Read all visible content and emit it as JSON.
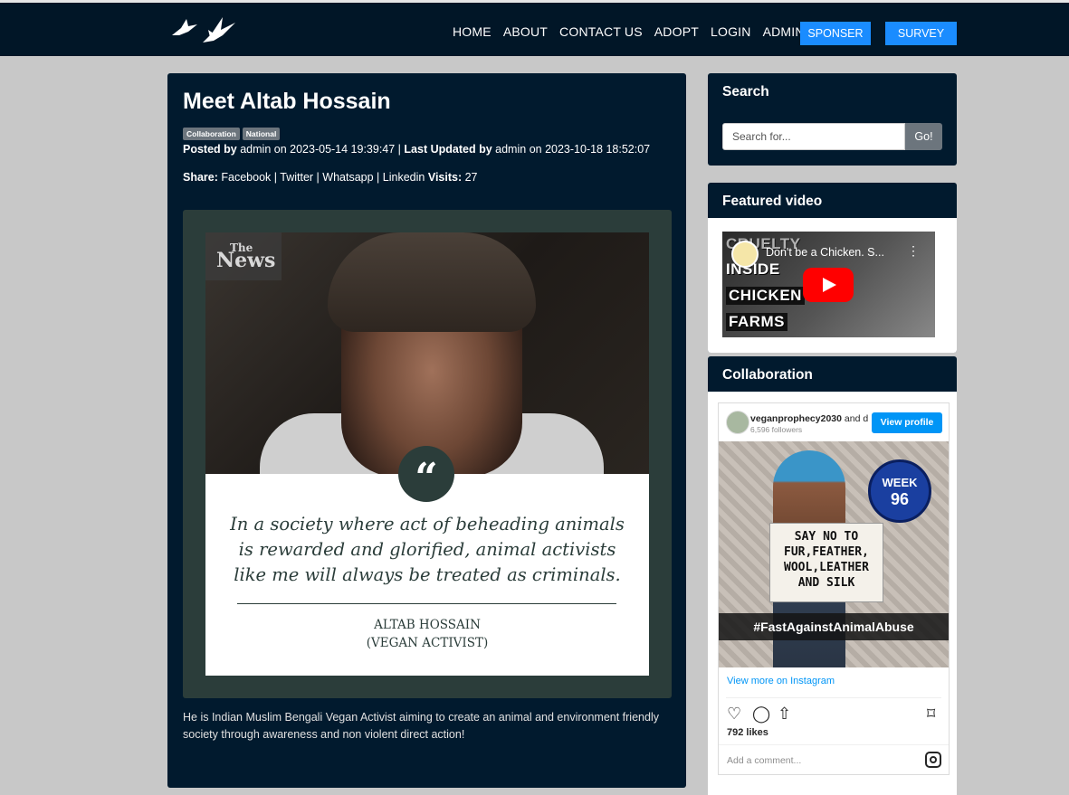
{
  "nav": {
    "links": [
      "HOME",
      "ABOUT",
      "CONTACT US",
      "ADOPT",
      "LOGIN",
      "ADMIN"
    ],
    "sponser": "SPONSER",
    "survey": "SURVEY"
  },
  "post": {
    "title": "Meet Altab Hossain",
    "badges": [
      "Collaboration",
      "National"
    ],
    "posted_by_label": "Posted by",
    "posted_by": "admin",
    "posted_on": "on 2023-05-14 19:39:47 |",
    "updated_label": "Last Updated by",
    "updated_by": "admin",
    "updated_on": "on 2023-10-18 18:52:07",
    "share_label": "Share:",
    "share_links": [
      "Facebook",
      "Twitter",
      "Whatsapp",
      "Linkedin"
    ],
    "visits_label": "Visits:",
    "visits": "27",
    "image": {
      "logo_the": "The",
      "logo_news": "News",
      "quote_mark": "“",
      "quote_lines": [
        "In a society where act of beheading animals",
        "is rewarded and glorified, animal activists",
        "like me will always be treated as criminals."
      ],
      "author": "ALTAB HOSSAIN",
      "author_role": "(VEGAN ACTIVIST)"
    },
    "description": "He is Indian Muslim Bengali Vegan Activist aiming to create an animal and environment friendly society through awareness and non violent direct action!"
  },
  "sidebar": {
    "search": {
      "title": "Search",
      "placeholder": "Search for...",
      "button": "Go!"
    },
    "video": {
      "title": "Featured video",
      "video_title": "Don't be a Chicken. S...",
      "thumb_words": [
        "CRUELTY",
        "INSIDE",
        "CHICKEN",
        "FARMS"
      ]
    },
    "collab": {
      "title": "Collaboration",
      "insta": {
        "user": "veganprophecy2030",
        "user_suffix": "and d",
        "followers": "6,596 followers",
        "view_profile": "View profile",
        "week_label": "WEEK",
        "week_num": "96",
        "sign_lines": [
          "SAY NO TO",
          "FUR,FEATHER,",
          "WOOL,LEATHER",
          "AND SILK"
        ],
        "hashtag": "#FastAgainstAnimalAbuse",
        "view_more": "View more on Instagram",
        "likes": "792 likes",
        "comment_placeholder": "Add a comment..."
      }
    }
  },
  "colors": {
    "navbar": "#011627",
    "card": "#011a2e",
    "accent": "#1a8cff",
    "page_bg": "#c8c8c8"
  }
}
